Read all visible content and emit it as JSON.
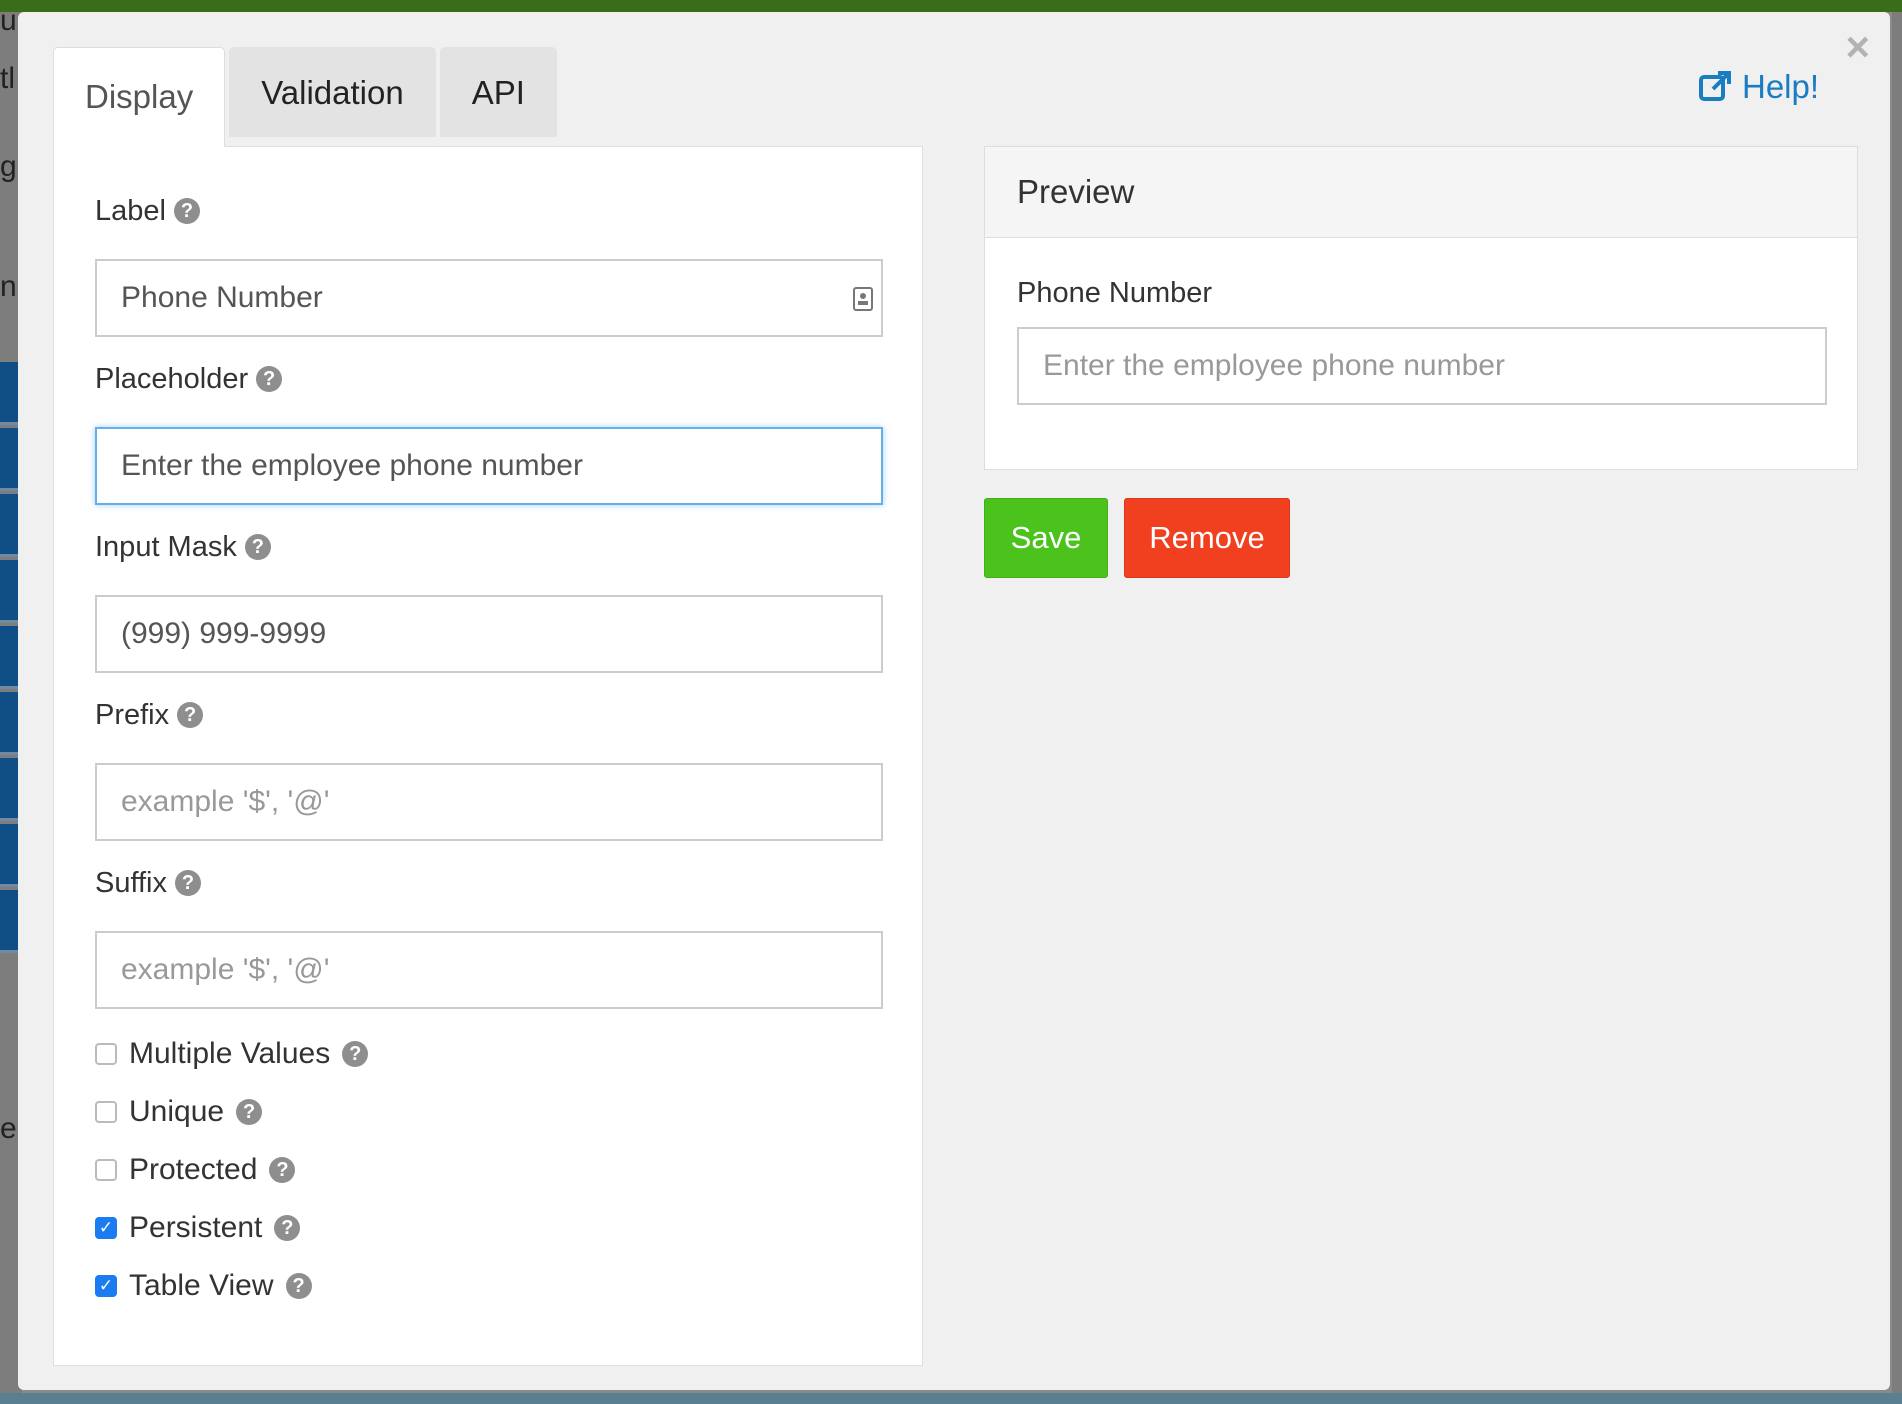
{
  "modal": {
    "close_glyph": "×",
    "help_label": "Help!",
    "tabs": [
      {
        "label": "Display",
        "active": true
      },
      {
        "label": "Validation",
        "active": false
      },
      {
        "label": "API",
        "active": false
      }
    ]
  },
  "display": {
    "label": {
      "title": "Label",
      "value": "Phone Number"
    },
    "placeholder": {
      "title": "Placeholder",
      "value": "Enter the employee phone number"
    },
    "input_mask": {
      "title": "Input Mask",
      "value": "(999) 999-9999"
    },
    "prefix": {
      "title": "Prefix",
      "placeholder": "example '$', '@'"
    },
    "suffix": {
      "title": "Suffix",
      "placeholder": "example '$', '@'"
    },
    "checkboxes": [
      {
        "label": "Multiple Values",
        "checked": false
      },
      {
        "label": "Unique",
        "checked": false
      },
      {
        "label": "Protected",
        "checked": false
      },
      {
        "label": "Persistent",
        "checked": true
      },
      {
        "label": "Table View",
        "checked": true
      }
    ]
  },
  "preview": {
    "title": "Preview",
    "field_label": "Phone Number",
    "field_placeholder": "Enter the employee phone number"
  },
  "actions": {
    "save_label": "Save",
    "remove_label": "Remove"
  },
  "background": {
    "letters": [
      "u",
      "tl",
      "g",
      "n",
      "e"
    ]
  },
  "colors": {
    "save": "#4cc31c",
    "remove": "#f0401f",
    "link": "#1a7cc1",
    "checkbox_on": "#1a7cf0",
    "focus_border": "#66afe9"
  },
  "icons": {
    "help": "external-link-icon",
    "hint": "question-circle-icon",
    "close": "close-icon"
  }
}
